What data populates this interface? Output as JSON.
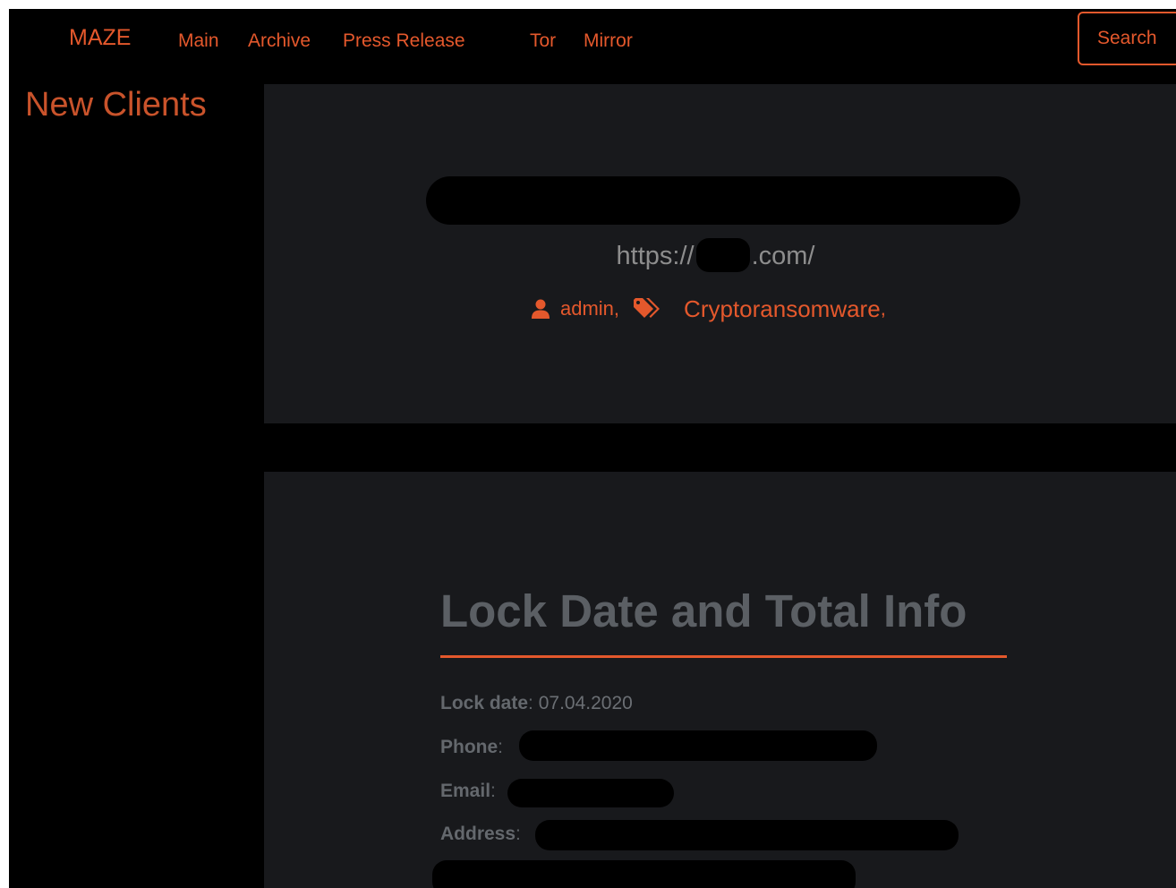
{
  "nav": {
    "brand": "MAZE",
    "links": [
      "Main",
      "Archive",
      "Press Release",
      "Tor",
      "Mirror"
    ],
    "search_label": "Search"
  },
  "sidebar": {
    "title": "New Clients"
  },
  "post": {
    "url_prefix": "https://",
    "url_suffix": ".com/",
    "author": "admin",
    "author_sep": ",",
    "category": "Cryptoransomware",
    "category_sep": ","
  },
  "info": {
    "heading": "Lock Date and Total Info",
    "lock_date_label": "Lock date",
    "lock_date_value": "07.04.2020",
    "phone_label": "Phone",
    "email_label": "Email",
    "address_label": "Address",
    "colon": ":"
  },
  "colors": {
    "accent": "#e4582c",
    "background": "#000000",
    "panel": "#18191c",
    "muted_text": "#5b5f64"
  },
  "icons": [
    "user-icon",
    "tags-icon"
  ]
}
